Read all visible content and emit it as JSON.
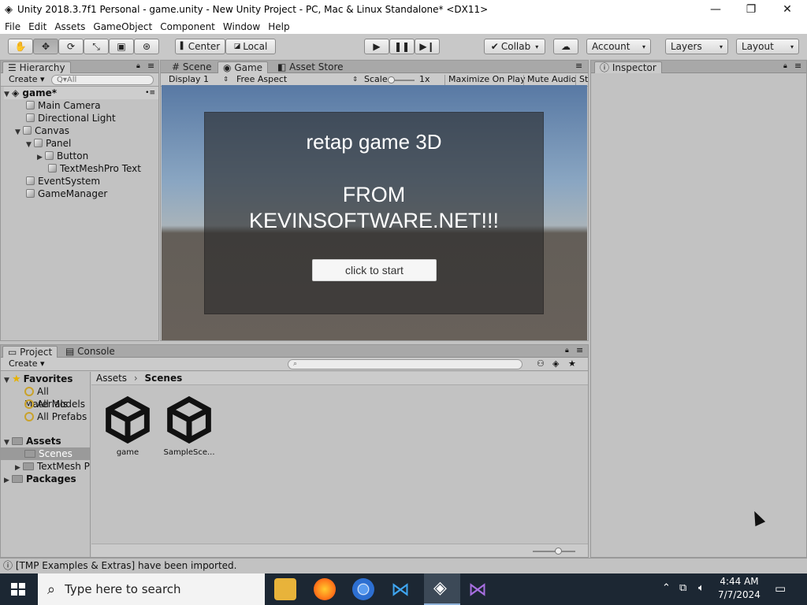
{
  "window": {
    "title": "Unity 2018.3.7f1 Personal - game.unity - New Unity Project - PC, Mac & Linux Standalone* <DX11>"
  },
  "menu": [
    "File",
    "Edit",
    "Assets",
    "GameObject",
    "Component",
    "Window",
    "Help"
  ],
  "toolbar": {
    "center": "Center",
    "local": "Local",
    "collab": "Collab",
    "account": "Account",
    "layers": "Layers",
    "layout": "Layout"
  },
  "hierarchy": {
    "tab": "Hierarchy",
    "create": "Create",
    "search_placeholder": "Q▾All",
    "scene": "game*",
    "items": [
      "Main Camera",
      "Directional Light",
      "Canvas",
      "Panel",
      "Button",
      "TextMeshPro Text",
      "EventSystem",
      "GameManager"
    ]
  },
  "center_tabs": [
    "Scene",
    "Game",
    "Asset Store"
  ],
  "game_toolbar": {
    "display": "Display 1",
    "aspect": "Free Aspect",
    "scale_label": "Scale",
    "scale_value": "1x",
    "maximize": "Maximize On Play",
    "mute": "Mute Audio",
    "stats": "St"
  },
  "game": {
    "title": "retap game 3D",
    "from": "FROM\nKEVINSOFTWARE.NET!!!",
    "button": "click to start"
  },
  "inspector": {
    "tab": "Inspector"
  },
  "project": {
    "tabs": [
      "Project",
      "Console"
    ],
    "create": "Create",
    "favorites": {
      "label": "Favorites",
      "items": [
        "All Materials",
        "All Models",
        "All Prefabs"
      ]
    },
    "assets": {
      "label": "Assets",
      "items": [
        "Scenes",
        "TextMesh P"
      ]
    },
    "packages": "Packages",
    "breadcrumb": [
      "Assets",
      "Scenes"
    ],
    "files": [
      "game",
      "SampleSce..."
    ]
  },
  "status": "[TMP Examples & Extras] have been imported.",
  "taskbar": {
    "search": "Type here to search",
    "time": "4:44 AM",
    "date": "7/7/2024"
  }
}
